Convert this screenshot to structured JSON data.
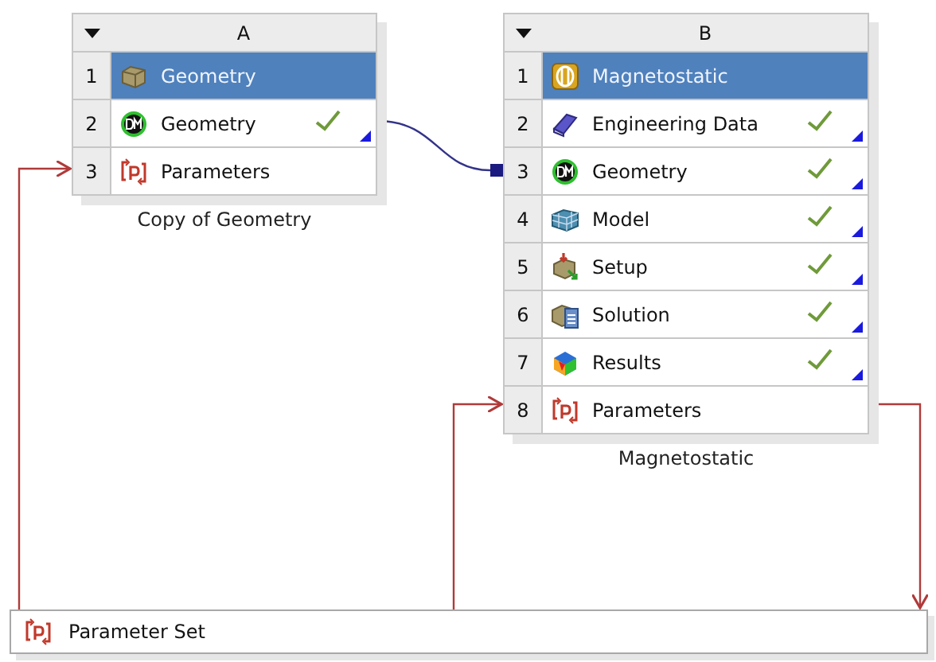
{
  "systems": [
    {
      "column": "A",
      "caption": "Copy of Geometry",
      "rows": [
        {
          "number": "1",
          "label": "Geometry",
          "kind": "block",
          "selected": true,
          "up_to_date": false
        },
        {
          "number": "2",
          "label": "Geometry",
          "kind": "dm",
          "selected": false,
          "up_to_date": true
        },
        {
          "number": "3",
          "label": "Parameters",
          "kind": "parameters",
          "selected": false,
          "up_to_date": false
        }
      ]
    },
    {
      "column": "B",
      "caption": "Magnetostatic",
      "rows": [
        {
          "number": "1",
          "label": "Magnetostatic",
          "kind": "magnet",
          "selected": true,
          "up_to_date": false
        },
        {
          "number": "2",
          "label": "Engineering Data",
          "kind": "book",
          "selected": false,
          "up_to_date": true
        },
        {
          "number": "3",
          "label": "Geometry",
          "kind": "dm",
          "selected": false,
          "up_to_date": true
        },
        {
          "number": "4",
          "label": "Model",
          "kind": "mesh",
          "selected": false,
          "up_to_date": true
        },
        {
          "number": "5",
          "label": "Setup",
          "kind": "setup",
          "selected": false,
          "up_to_date": true
        },
        {
          "number": "6",
          "label": "Solution",
          "kind": "solution",
          "selected": false,
          "up_to_date": true
        },
        {
          "number": "7",
          "label": "Results",
          "kind": "results",
          "selected": false,
          "up_to_date": true
        },
        {
          "number": "8",
          "label": "Parameters",
          "kind": "parameters",
          "selected": false,
          "up_to_date": false
        }
      ]
    }
  ],
  "parameter_set": {
    "label": "Parameter Set"
  }
}
